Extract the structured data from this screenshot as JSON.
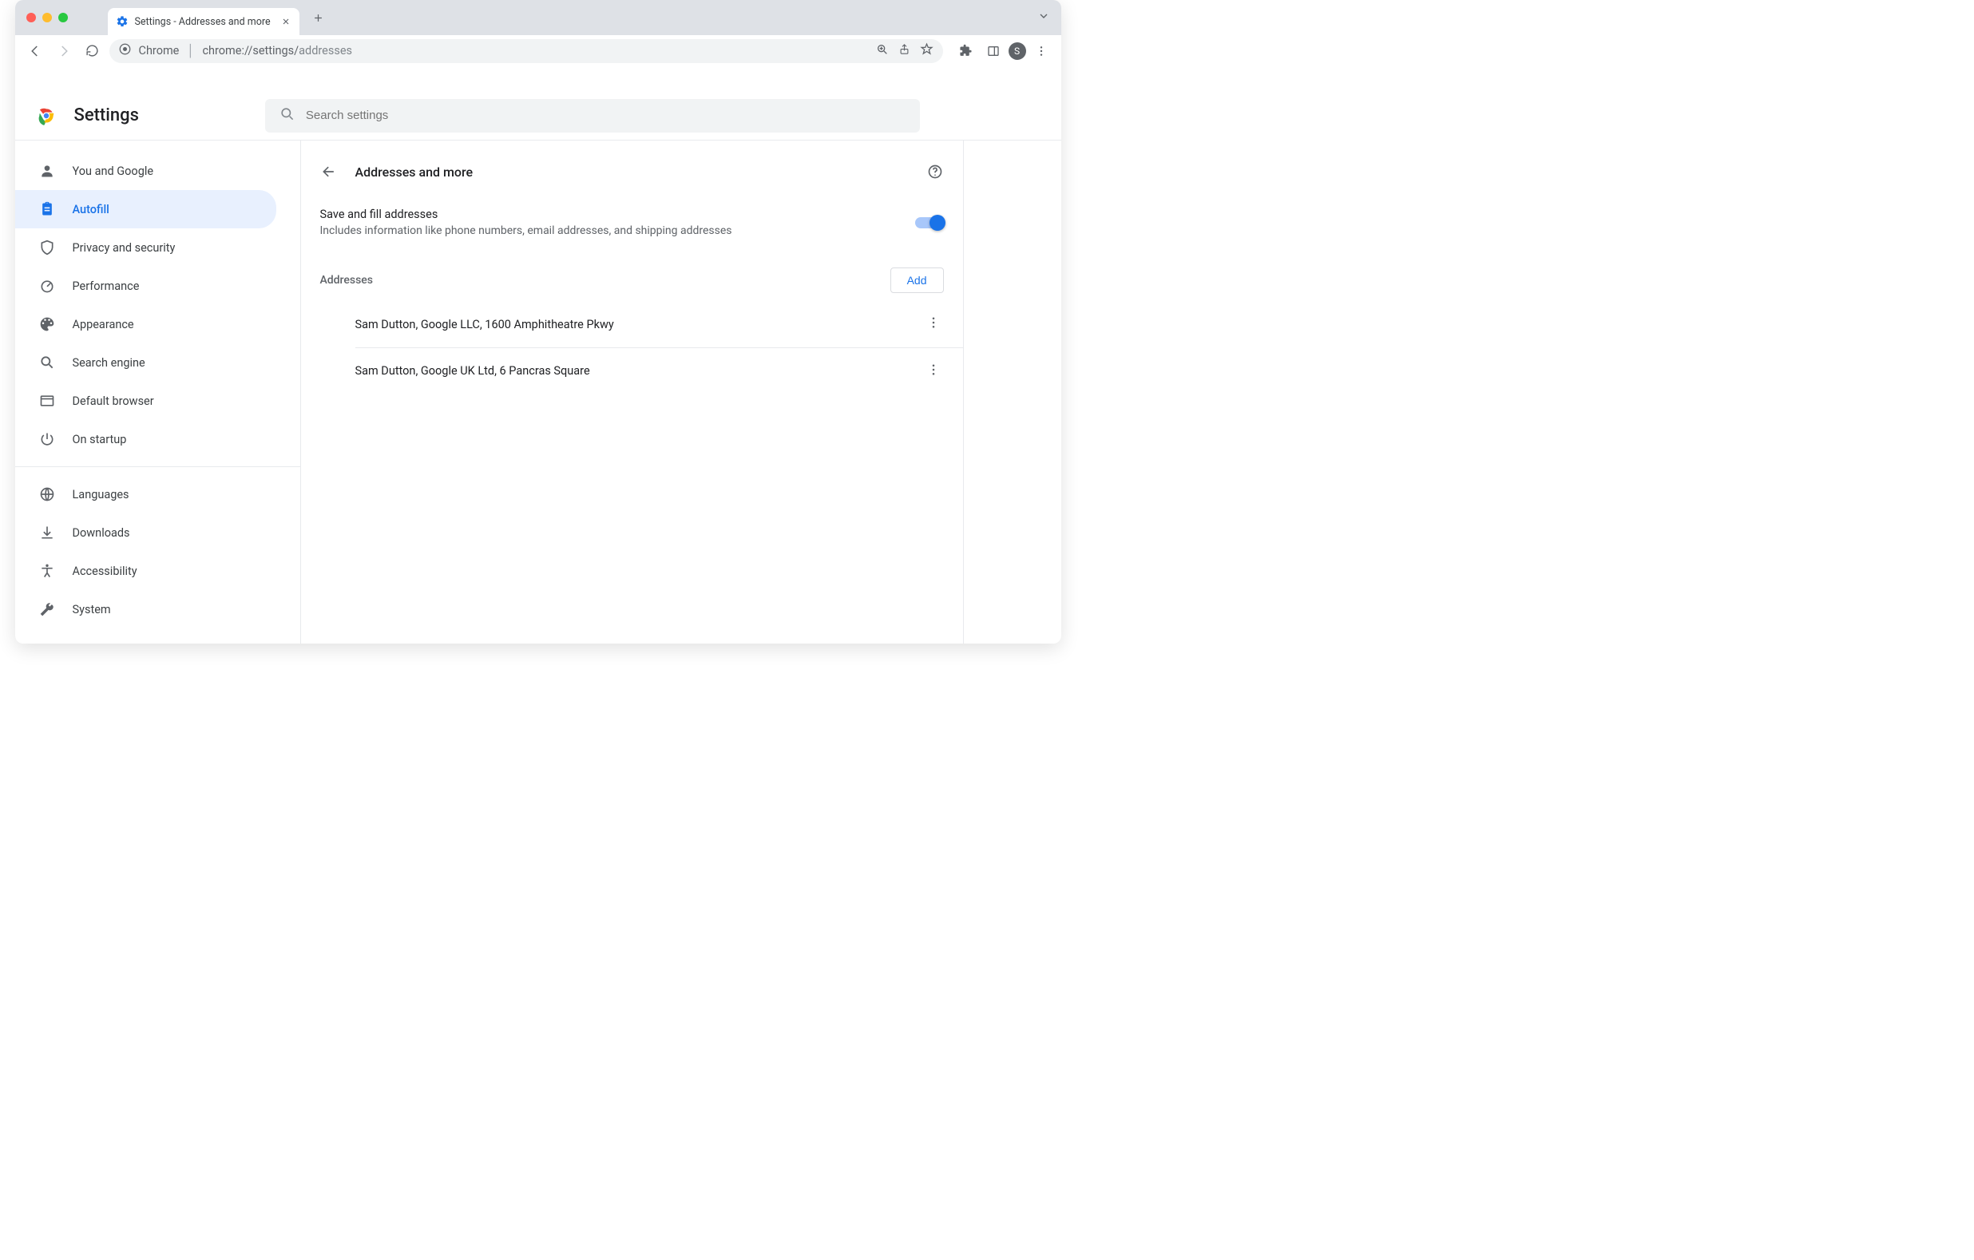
{
  "tab": {
    "title": "Settings - Addresses and more"
  },
  "omnibox": {
    "scheme_label": "Chrome",
    "url_prefix": "chrome://settings/",
    "url_suffix": "addresses"
  },
  "avatar_initial": "S",
  "header": {
    "title": "Settings",
    "search_placeholder": "Search settings"
  },
  "sidebar": {
    "items": [
      {
        "label": "You and Google"
      },
      {
        "label": "Autofill"
      },
      {
        "label": "Privacy and security"
      },
      {
        "label": "Performance"
      },
      {
        "label": "Appearance"
      },
      {
        "label": "Search engine"
      },
      {
        "label": "Default browser"
      },
      {
        "label": "On startup"
      }
    ],
    "items2": [
      {
        "label": "Languages"
      },
      {
        "label": "Downloads"
      },
      {
        "label": "Accessibility"
      },
      {
        "label": "System"
      }
    ]
  },
  "page": {
    "title": "Addresses and more",
    "save_fill_label": "Save and fill addresses",
    "save_fill_sub": "Includes information like phone numbers, email addresses, and shipping addresses",
    "addresses_label": "Addresses",
    "add_label": "Add",
    "addresses": [
      "Sam Dutton, Google LLC, 1600 Amphitheatre Pkwy",
      "Sam Dutton, Google UK Ltd, 6 Pancras Square"
    ]
  }
}
